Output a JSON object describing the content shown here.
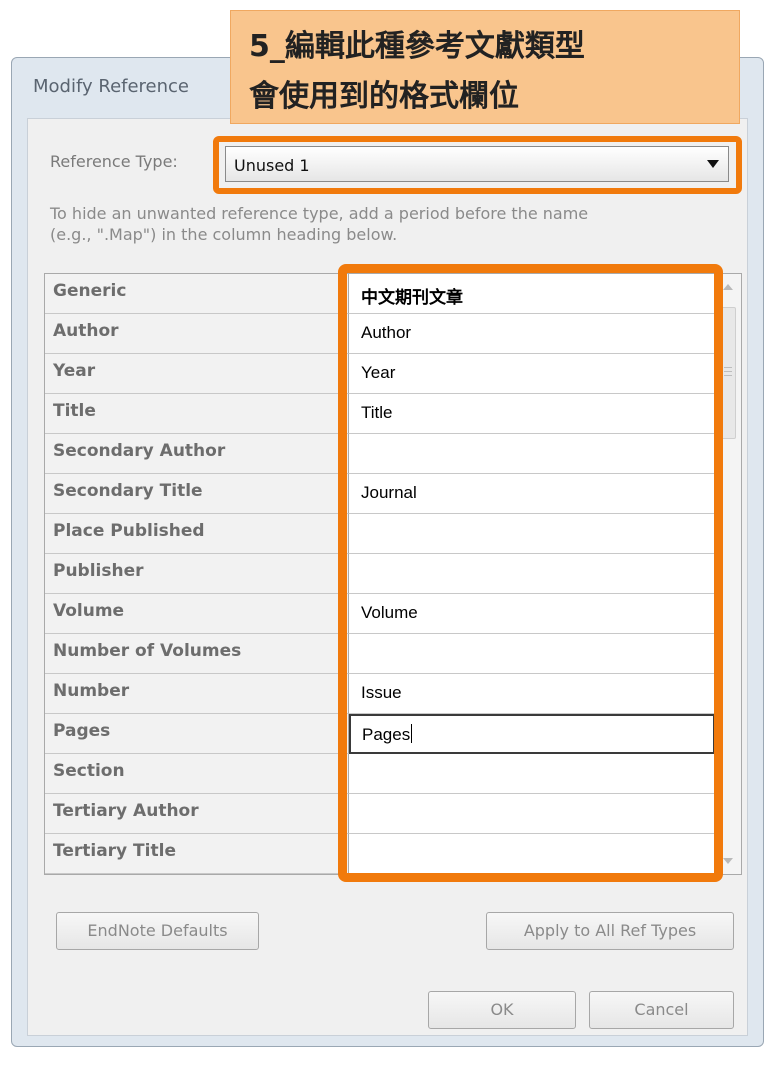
{
  "dialog": {
    "title": "Modify Reference",
    "reference_type_label": "Reference Type:",
    "reference_type_value": "Unused 1",
    "hint_line1": "To hide an unwanted reference type, add a period before the name",
    "hint_line2": "(e.g., \".Map\") in the column heading below."
  },
  "grid": {
    "rows": [
      {
        "label": "Generic",
        "value": "中文期刊文章"
      },
      {
        "label": "Author",
        "value": "Author"
      },
      {
        "label": "Year",
        "value": "Year"
      },
      {
        "label": "Title",
        "value": "Title"
      },
      {
        "label": "Secondary Author",
        "value": ""
      },
      {
        "label": "Secondary Title",
        "value": "Journal"
      },
      {
        "label": "Place Published",
        "value": ""
      },
      {
        "label": "Publisher",
        "value": ""
      },
      {
        "label": "Volume",
        "value": "Volume"
      },
      {
        "label": "Number of Volumes",
        "value": ""
      },
      {
        "label": "Number",
        "value": "Issue"
      },
      {
        "label": "Pages",
        "value": "Pages"
      },
      {
        "label": "Section",
        "value": ""
      },
      {
        "label": "Tertiary Author",
        "value": ""
      },
      {
        "label": "Tertiary Title",
        "value": ""
      }
    ]
  },
  "buttons": {
    "endnote_defaults": "EndNote Defaults",
    "apply_all": "Apply to All Ref Types",
    "ok": "OK",
    "cancel": "Cancel"
  },
  "callout": {
    "line1": "5_編輯此種參考文獻類型",
    "line2": "會使用到的格式欄位"
  },
  "colors": {
    "highlight": "#f17a0c",
    "callout_bg": "#f9c58d"
  }
}
